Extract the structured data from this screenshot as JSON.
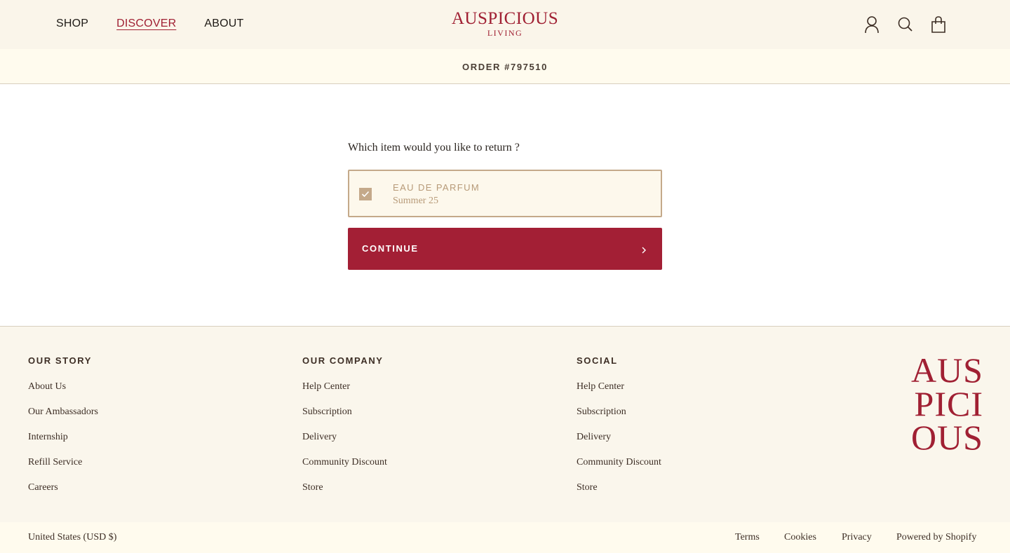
{
  "header": {
    "nav": {
      "shop": "SHOP",
      "discover": "DISCOVER",
      "about": "ABOUT"
    },
    "logo_line1": "AUSPICIOUS",
    "logo_line2": "LIVING",
    "icons": [
      "account-icon",
      "search-icon",
      "cart-icon"
    ]
  },
  "order_bar": {
    "text": "ORDER #797510"
  },
  "main": {
    "question": "Which item would you like to return ?",
    "item": {
      "title": "EAU DE PARFUM",
      "subtitle": "Summer 25",
      "checked": true
    },
    "continue_label": "CONTINUE"
  },
  "footer": {
    "columns": [
      {
        "title": "OUR STORY",
        "links": [
          "About Us",
          "Our Ambassadors",
          "Internship",
          "Refill Service",
          "Careers"
        ]
      },
      {
        "title": "OUR COMPANY",
        "links": [
          "Help Center",
          "Subscription",
          "Delivery",
          "Community Discount",
          "Store"
        ]
      },
      {
        "title": "SOCIAL",
        "links": [
          "Help Center",
          "Subscription",
          "Delivery",
          "Community Discount",
          "Store"
        ]
      }
    ],
    "logo_lines": [
      "AUS",
      "PICI",
      "OUS"
    ],
    "country": "United States (USD $)",
    "legal": {
      "terms": "Terms",
      "cookies": "Cookies",
      "privacy": "Privacy",
      "powered": "Powered by Shopify"
    }
  },
  "colors": {
    "brand_red": "#a31f35",
    "cream": "#faf5ea",
    "tan": "#c4a98a"
  }
}
